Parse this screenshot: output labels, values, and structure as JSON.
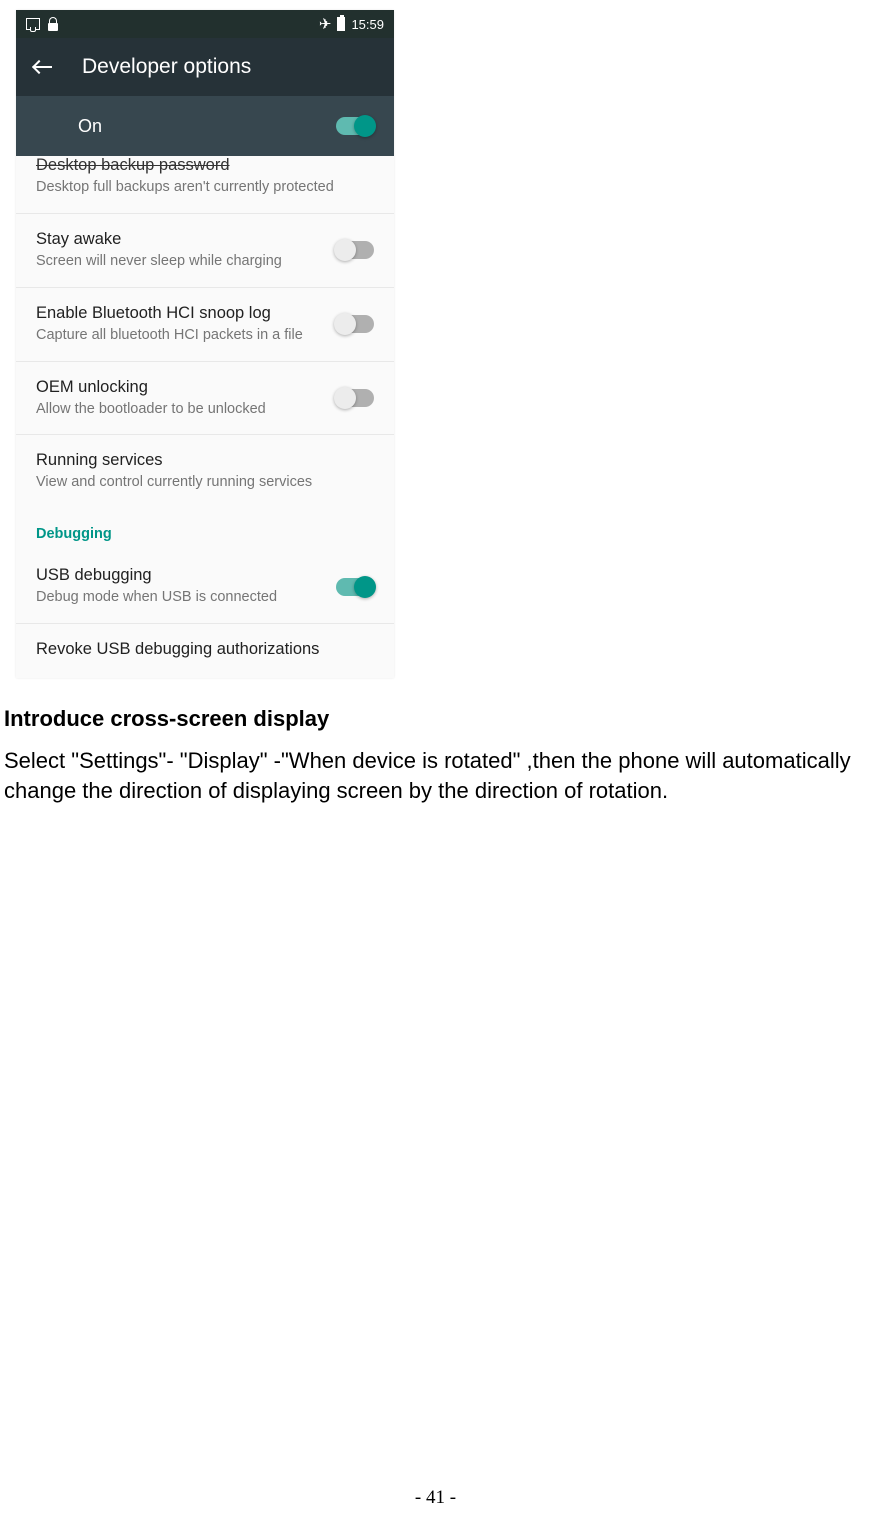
{
  "statusBar": {
    "time": "15:59"
  },
  "appBar": {
    "title": "Developer options"
  },
  "masterSwitch": {
    "label": "On"
  },
  "items": {
    "desktopBackup": {
      "title": "Desktop backup password",
      "subtitle": "Desktop full backups aren't currently protected"
    },
    "stayAwake": {
      "title": "Stay awake",
      "subtitle": "Screen will never sleep while charging"
    },
    "bluetoothHci": {
      "title": "Enable Bluetooth HCI snoop log",
      "subtitle": "Capture all bluetooth HCI packets in a file"
    },
    "oemUnlocking": {
      "title": "OEM unlocking",
      "subtitle": "Allow the bootloader to be unlocked"
    },
    "runningServices": {
      "title": "Running services",
      "subtitle": "View and control currently running services"
    },
    "usbDebugging": {
      "title": "USB debugging",
      "subtitle": "Debug mode when USB is connected"
    },
    "revokeUsb": {
      "title": "Revoke USB debugging authorizations"
    }
  },
  "sections": {
    "debugging": "Debugging"
  },
  "doc": {
    "heading": "Introduce cross-screen display",
    "body": "Select \"Settings\"- \"Display\" -\"When device is rotated\" ,then the phone will automatically change the direction of displaying screen by the direction of rotation.",
    "pageNumber": "- 41 -"
  }
}
